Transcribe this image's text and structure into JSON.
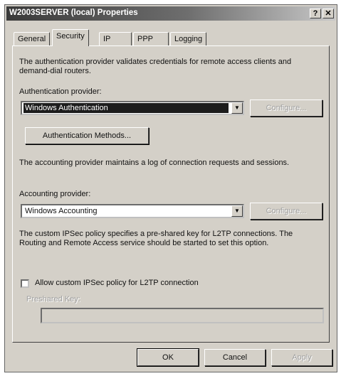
{
  "window": {
    "title": "W2003SERVER (local) Properties",
    "help_glyph": "?",
    "close_glyph": "✕"
  },
  "tabs": [
    {
      "label": "General"
    },
    {
      "label": "Security",
      "active": true
    },
    {
      "label": "IP"
    },
    {
      "label": "PPP"
    },
    {
      "label": "Logging"
    }
  ],
  "security": {
    "auth_description": "The authentication provider validates credentials for remote access clients and demand-dial routers.",
    "auth_provider_label": "Authentication provider:",
    "auth_provider_value": "Windows Authentication",
    "auth_configure_label": "Configure...",
    "auth_methods_label": "Authentication Methods...",
    "acct_description": "The accounting provider maintains a log of connection requests and sessions.",
    "acct_provider_label": "Accounting provider:",
    "acct_provider_value": "Windows Accounting",
    "acct_configure_label": "Configure...",
    "ipsec_description": "The custom IPSec policy specifies a pre-shared key for L2TP connections. The Routing and Remote Access service should be started to set this option.",
    "ipsec_checkbox_label": "Allow custom IPSec policy for L2TP connection",
    "ipsec_checked": false,
    "preshared_key_label": "Preshared Key:",
    "preshared_key_value": ""
  },
  "footer": {
    "ok_label": "OK",
    "cancel_label": "Cancel",
    "apply_label": "Apply"
  }
}
